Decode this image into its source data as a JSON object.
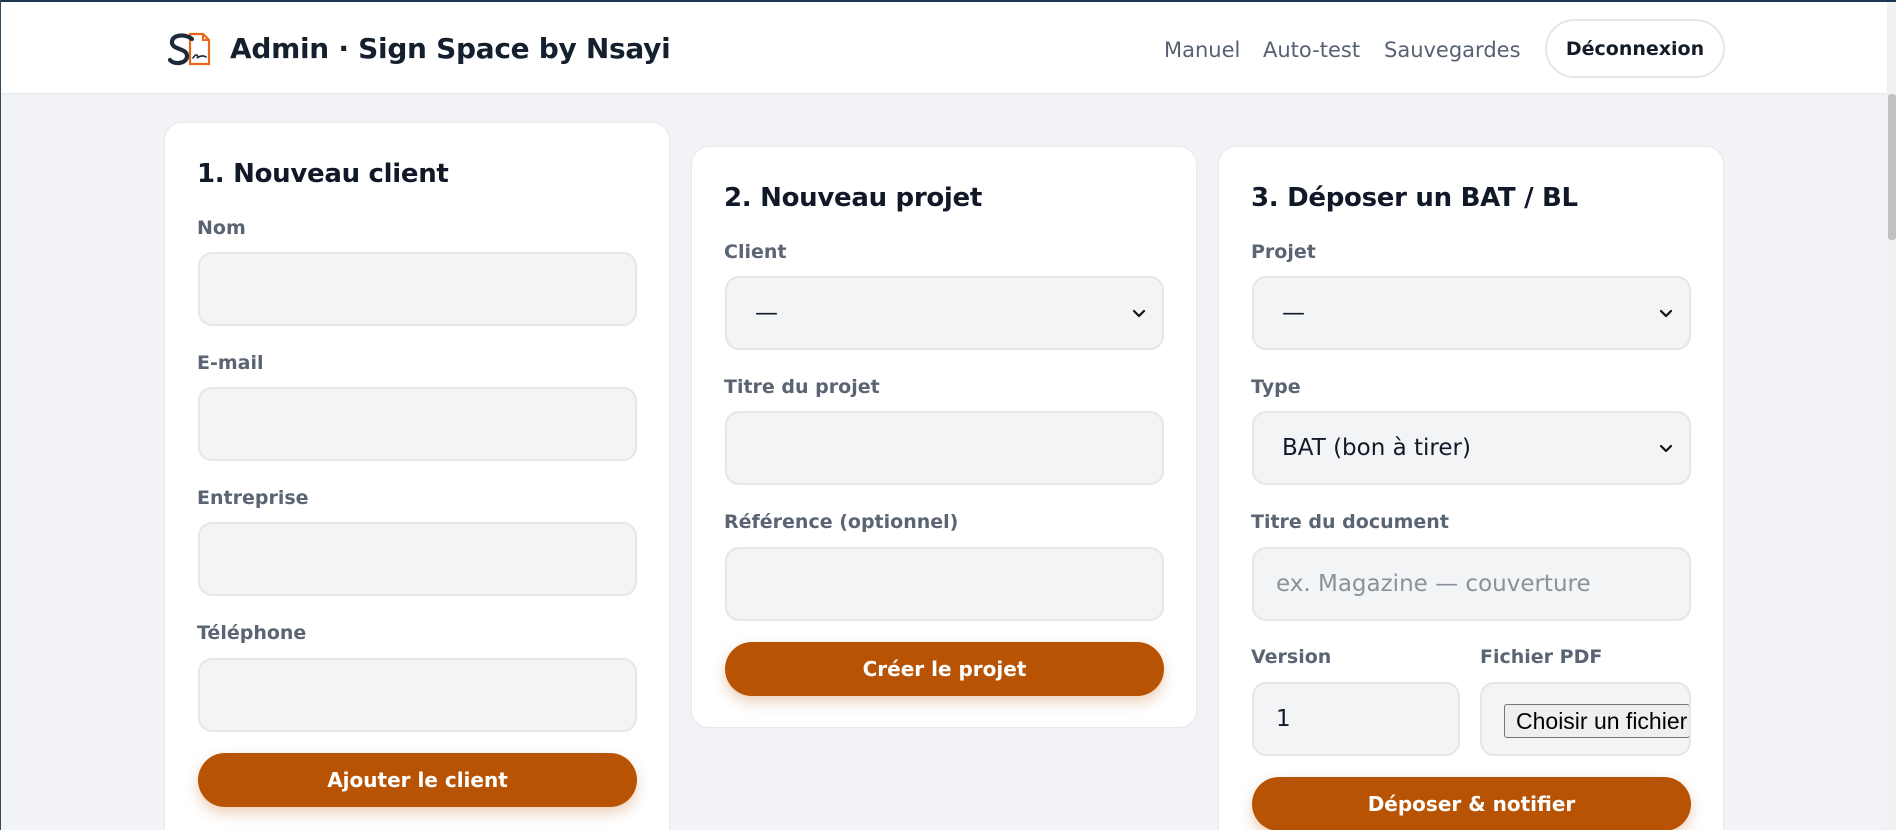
{
  "header": {
    "brand": "Admin · Sign Space by Nsayi",
    "nav": {
      "manual": "Manuel",
      "self_test": "Auto-test",
      "backups": "Sauvegardes"
    },
    "logout": "Déconnexion"
  },
  "client_card": {
    "title": "1. Nouveau client",
    "name_label": "Nom",
    "name_value": "",
    "email_label": "E-mail",
    "email_value": "",
    "company_label": "Entreprise",
    "company_value": "",
    "phone_label": "Téléphone",
    "phone_value": "",
    "submit": "Ajouter le client"
  },
  "project_card": {
    "title": "2. Nouveau projet",
    "client_label": "Client",
    "client_selected": "—",
    "project_title_label": "Titre du projet",
    "project_title_value": "",
    "reference_label": "Référence (optionnel)",
    "reference_value": "",
    "submit": "Créer le projet"
  },
  "upload_card": {
    "title": "3. Déposer un BAT / BL",
    "project_label": "Projet",
    "project_selected": "—",
    "type_label": "Type",
    "type_selected": "BAT (bon à tirer)",
    "doc_title_label": "Titre du document",
    "doc_title_placeholder": "ex. Magazine — couverture",
    "version_label": "Version",
    "version_value": "1",
    "file_label": "Fichier PDF",
    "file_button": "Choisir un fichier",
    "submit": "Déposer & notifier"
  },
  "colors": {
    "accent": "#b85303",
    "page_bg": "#f2f3f6",
    "card_bg": "#ffffff",
    "input_bg": "#f3f4f6",
    "logo_orange": "#e8671a",
    "logo_navy": "#1e2a3a"
  },
  "icons": {
    "logo": "sign-space-logo",
    "select_arrow": "chevron-down-icon"
  }
}
